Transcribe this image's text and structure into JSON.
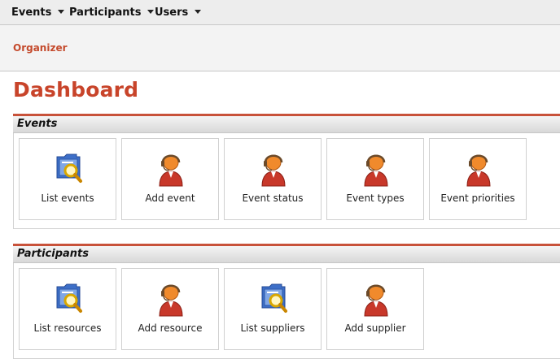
{
  "menubar": {
    "items": [
      {
        "label": "Events"
      },
      {
        "label": "Participants"
      },
      {
        "label": "Users"
      }
    ]
  },
  "organizer": {
    "label": "Organizer"
  },
  "page": {
    "title": "Dashboard"
  },
  "sections": [
    {
      "title": "Events",
      "tiles": [
        {
          "label": "List events",
          "icon": "folder-search-icon"
        },
        {
          "label": "Add event",
          "icon": "person-headset-icon"
        },
        {
          "label": "Event status",
          "icon": "person-headset-icon"
        },
        {
          "label": "Event types",
          "icon": "person-headset-icon"
        },
        {
          "label": "Event priorities",
          "icon": "person-headset-icon"
        }
      ]
    },
    {
      "title": "Participants",
      "tiles": [
        {
          "label": "List resources",
          "icon": "folder-search-icon"
        },
        {
          "label": "Add resource",
          "icon": "person-headset-icon"
        },
        {
          "label": "List suppliers",
          "icon": "folder-search-icon"
        },
        {
          "label": "Add supplier",
          "icon": "person-headset-icon"
        }
      ]
    }
  ],
  "colors": {
    "accent": "#c8442a",
    "section_rule": "#c8523a",
    "menubar_bg": "#ededed",
    "orgbar_bg": "#f3f3f3"
  }
}
